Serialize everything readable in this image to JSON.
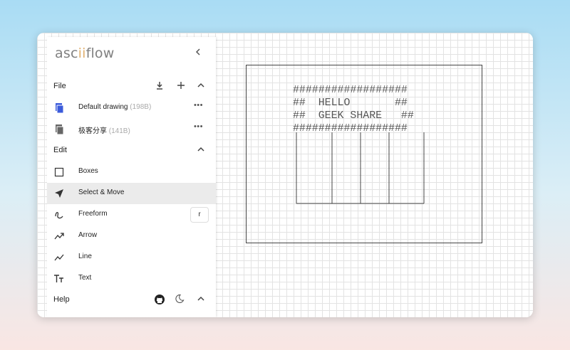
{
  "app": {
    "logo_left": "asc",
    "logo_ii": "ii",
    "logo_right": "flow"
  },
  "sidebar": {
    "file": {
      "title": "File",
      "drawings": [
        {
          "name": "Default drawing",
          "size": "(198B)"
        },
        {
          "name": "极客分享",
          "size": "(141B)"
        }
      ]
    },
    "edit": {
      "title": "Edit",
      "tools": [
        {
          "label": "Boxes",
          "icon": "box-icon"
        },
        {
          "label": "Select & Move",
          "icon": "cursor-icon",
          "selected": true
        },
        {
          "label": "Freeform",
          "icon": "freeform-icon",
          "shortcut": "r"
        },
        {
          "label": "Arrow",
          "icon": "arrow-icon"
        },
        {
          "label": "Line",
          "icon": "line-icon"
        },
        {
          "label": "Text",
          "icon": "text-icon"
        }
      ]
    },
    "help": {
      "title": "Help"
    }
  },
  "canvas": {
    "ascii_art": "##################\n##  HELLO       ##\n##  GEEK SHARE   ##\n##################"
  },
  "colors": {
    "accent": "#e0b070",
    "grid": "#e3e3e3",
    "file_icon": "#3b5bdb"
  }
}
